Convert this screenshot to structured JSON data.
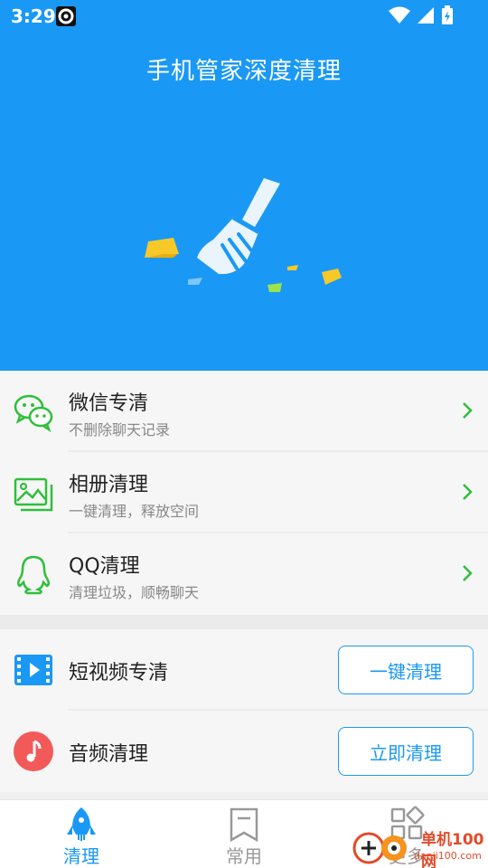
{
  "status_bar": {
    "time": "3:29"
  },
  "hero": {
    "title": "手机管家深度清理"
  },
  "clean_items": [
    {
      "title": "微信专清",
      "subtitle": "不删除聊天记录"
    },
    {
      "title": "相册清理",
      "subtitle": "一键清理，释放空间"
    },
    {
      "title": "QQ清理",
      "subtitle": "清理垃圾，顺畅聊天"
    }
  ],
  "tool_items": [
    {
      "title": "短视频专清",
      "button": "一键清理"
    },
    {
      "title": "音频清理",
      "button": "立即清理"
    }
  ],
  "bottom_nav": [
    {
      "label": "清理",
      "active": true
    },
    {
      "label": "常用",
      "active": false
    },
    {
      "label": "更多",
      "active": false
    }
  ],
  "watermark": {
    "line1": "单机100网",
    "line2": "danji100.com"
  },
  "colors": {
    "primary": "#1a98f5",
    "green": "#2fbf3a",
    "audio_red": "#f25a5a"
  }
}
